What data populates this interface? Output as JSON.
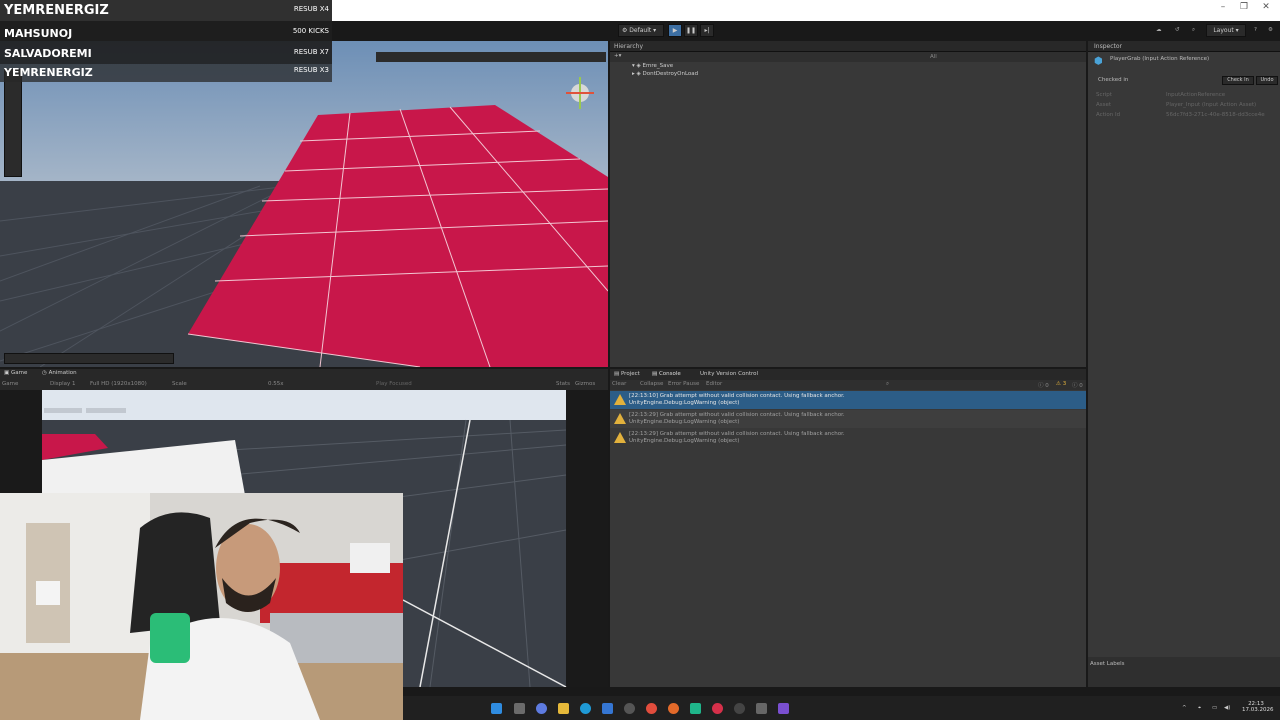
{
  "scoreboard": [
    {
      "name": "YEMRENERGIZ",
      "value": "RESUB X4"
    },
    {
      "name": "MAHSUNOJ",
      "value": "500 KICKS"
    },
    {
      "name": "SALVADOREMI",
      "value": "RESUB X7"
    },
    {
      "name": "YEMRENERGIZ",
      "value": "RESUB X3"
    }
  ],
  "toolbar": {
    "layout_mode": "Default",
    "layout_label": "Layout"
  },
  "hierarchy": {
    "tab": "Hierarchy",
    "search_placeholder": "All",
    "items": [
      "Emre_Save",
      "DontDestroyOnLoad"
    ]
  },
  "inspector": {
    "tab": "Inspector",
    "object_title": "PlayerGrab (Input Action Reference)",
    "checked_in": "Checked in",
    "check_in_button": "Check In",
    "undo_button": "Undo",
    "fields": [
      {
        "label": "Script",
        "value": "InputActionReference"
      },
      {
        "label": "Asset",
        "value": "Player_Input (Input Action Asset)"
      },
      {
        "label": "Action Id",
        "value": "56dc7fd3-271c-40e-8518-dd3cce4e"
      }
    ],
    "asset_labels": "Asset Labels"
  },
  "game_view": {
    "tabs": [
      "Game",
      "Animation"
    ],
    "display": "Display 1",
    "resolution": "Full HD (1920x1080)",
    "scale_label": "Scale",
    "scale_value": "0.55x",
    "play_focused": "Play Focused",
    "stats": "Stats",
    "gizmos": "Gizmos"
  },
  "console": {
    "tabs": [
      "Project",
      "Console",
      "Unity Version Control"
    ],
    "clear": "Clear",
    "collapse": "Collapse",
    "error_pause": "Error Pause",
    "editor": "Editor",
    "counts": {
      "errors": "0",
      "warnings": "3",
      "messages": "0"
    },
    "logs": [
      {
        "line1": "[22:13:10] Grab attempt without valid collision contact. Using fallback anchor.",
        "line2": "UnityEngine.Debug:LogWarning (object)",
        "selected": true
      },
      {
        "line1": "[22:13:29] Grab attempt without valid collision contact. Using fallback anchor.",
        "line2": "UnityEngine.Debug:LogWarning (object)",
        "selected": false
      },
      {
        "line1": "[22:13:29] Grab attempt without valid collision contact. Using fallback anchor.",
        "line2": "UnityEngine.Debug:LogWarning (object)",
        "selected": false
      }
    ]
  },
  "taskbar": {
    "time": "22:13",
    "date": "17.03.2026"
  },
  "colors": {
    "accent": "#2c5d87",
    "platform": "#c8174a",
    "warning": "#e2b13c"
  }
}
